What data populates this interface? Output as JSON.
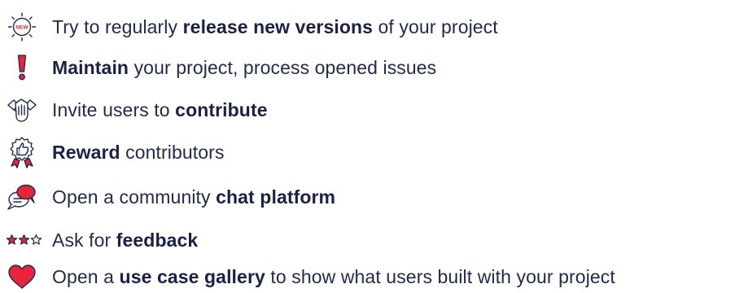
{
  "items": [
    {
      "icon": "new-badge-icon",
      "pre": "Try to regularly ",
      "bold": "release new versions",
      "post": " of your project",
      "badge_text": "NEW"
    },
    {
      "icon": "exclamation-icon",
      "pre": "",
      "bold": "Maintain",
      "post": " your project, process opened issues"
    },
    {
      "icon": "handshake-icon",
      "pre": "Invite users to ",
      "bold": "contribute",
      "post": ""
    },
    {
      "icon": "thumbs-up-award-icon",
      "pre": "",
      "bold": "Reward",
      "post": " contributors"
    },
    {
      "icon": "chat-bubbles-icon",
      "pre": "Open a community ",
      "bold": "chat platform",
      "post": ""
    },
    {
      "icon": "three-stars-icon",
      "pre": "Ask for ",
      "bold": "feedback",
      "post": ""
    },
    {
      "icon": "heart-icon",
      "pre": "Open a ",
      "bold": "use case gallery",
      "post": " to show what users built with your project"
    }
  ],
  "colors": {
    "text": "#1f2a4d",
    "accent_red": "#e8243c",
    "outline": "#1f2a4d"
  }
}
